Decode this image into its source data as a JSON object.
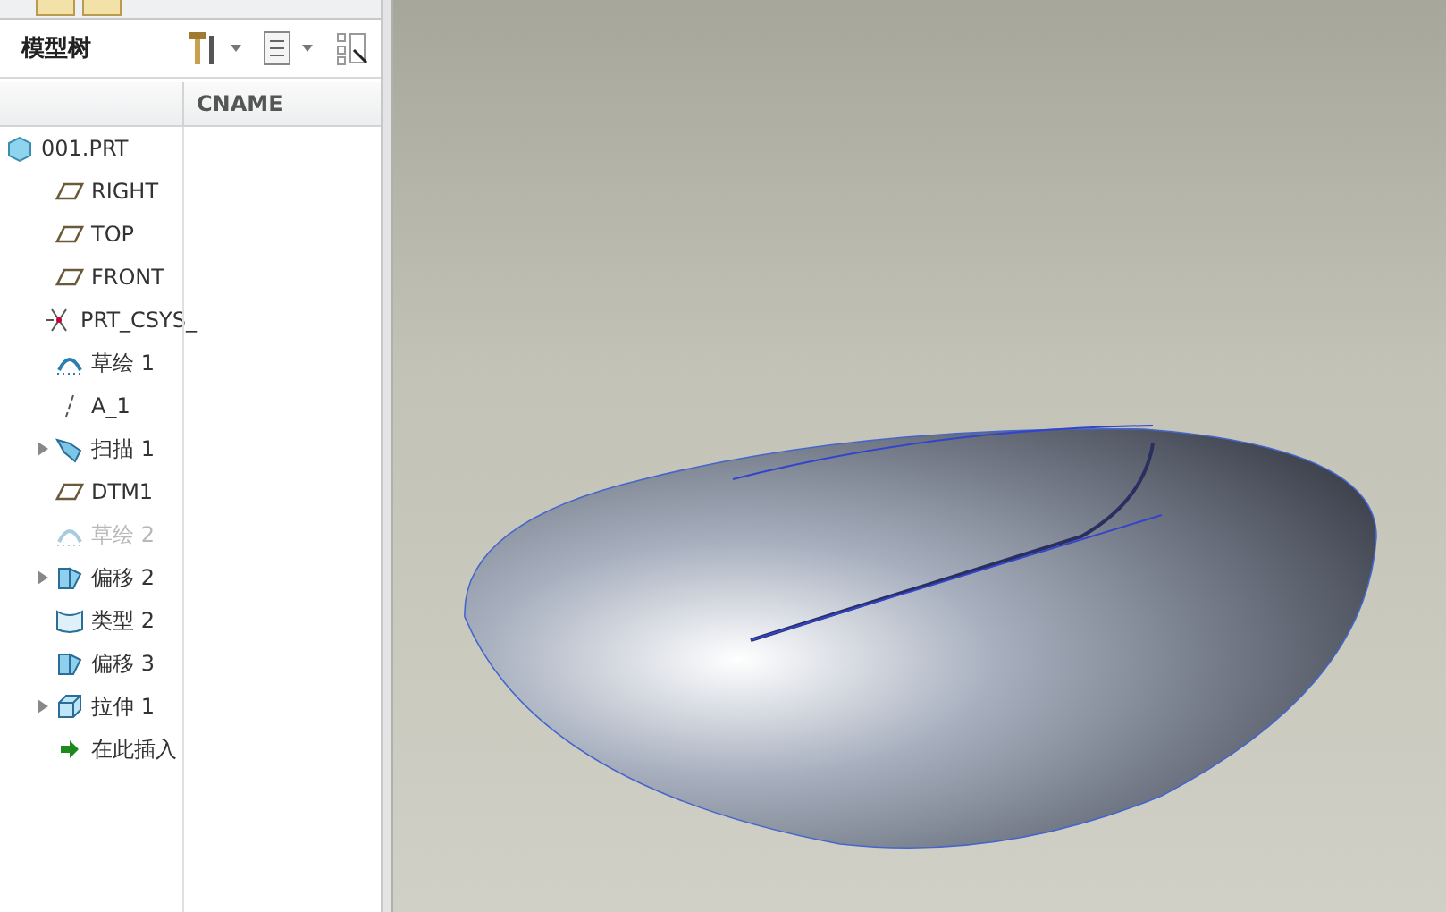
{
  "panel": {
    "title": "模型树",
    "column_header": "CNAME"
  },
  "tree": [
    {
      "label": "001.PRT",
      "kind": "part",
      "expandable": false,
      "disabled": false,
      "children": [
        {
          "label": "RIGHT",
          "kind": "plane",
          "expandable": false,
          "disabled": false
        },
        {
          "label": "TOP",
          "kind": "plane",
          "expandable": false,
          "disabled": false
        },
        {
          "label": "FRONT",
          "kind": "plane",
          "expandable": false,
          "disabled": false
        },
        {
          "label": "PRT_CSYS_",
          "kind": "csys",
          "expandable": false,
          "disabled": false
        },
        {
          "label": "草绘 1",
          "kind": "sketch",
          "expandable": false,
          "disabled": false
        },
        {
          "label": "A_1",
          "kind": "axis",
          "expandable": false,
          "disabled": false
        },
        {
          "label": "扫描 1",
          "kind": "sweep",
          "expandable": true,
          "disabled": false
        },
        {
          "label": "DTM1",
          "kind": "plane",
          "expandable": false,
          "disabled": false
        },
        {
          "label": "草绘 2",
          "kind": "sketch",
          "expandable": false,
          "disabled": true
        },
        {
          "label": "偏移 2",
          "kind": "offset",
          "expandable": true,
          "disabled": false
        },
        {
          "label": "类型 2",
          "kind": "surface",
          "expandable": false,
          "disabled": false
        },
        {
          "label": "偏移 3",
          "kind": "offset",
          "expandable": false,
          "disabled": false
        },
        {
          "label": "拉伸 1",
          "kind": "extrude",
          "expandable": true,
          "disabled": false
        },
        {
          "label": "在此插入",
          "kind": "insert",
          "expandable": false,
          "disabled": false
        }
      ]
    }
  ]
}
